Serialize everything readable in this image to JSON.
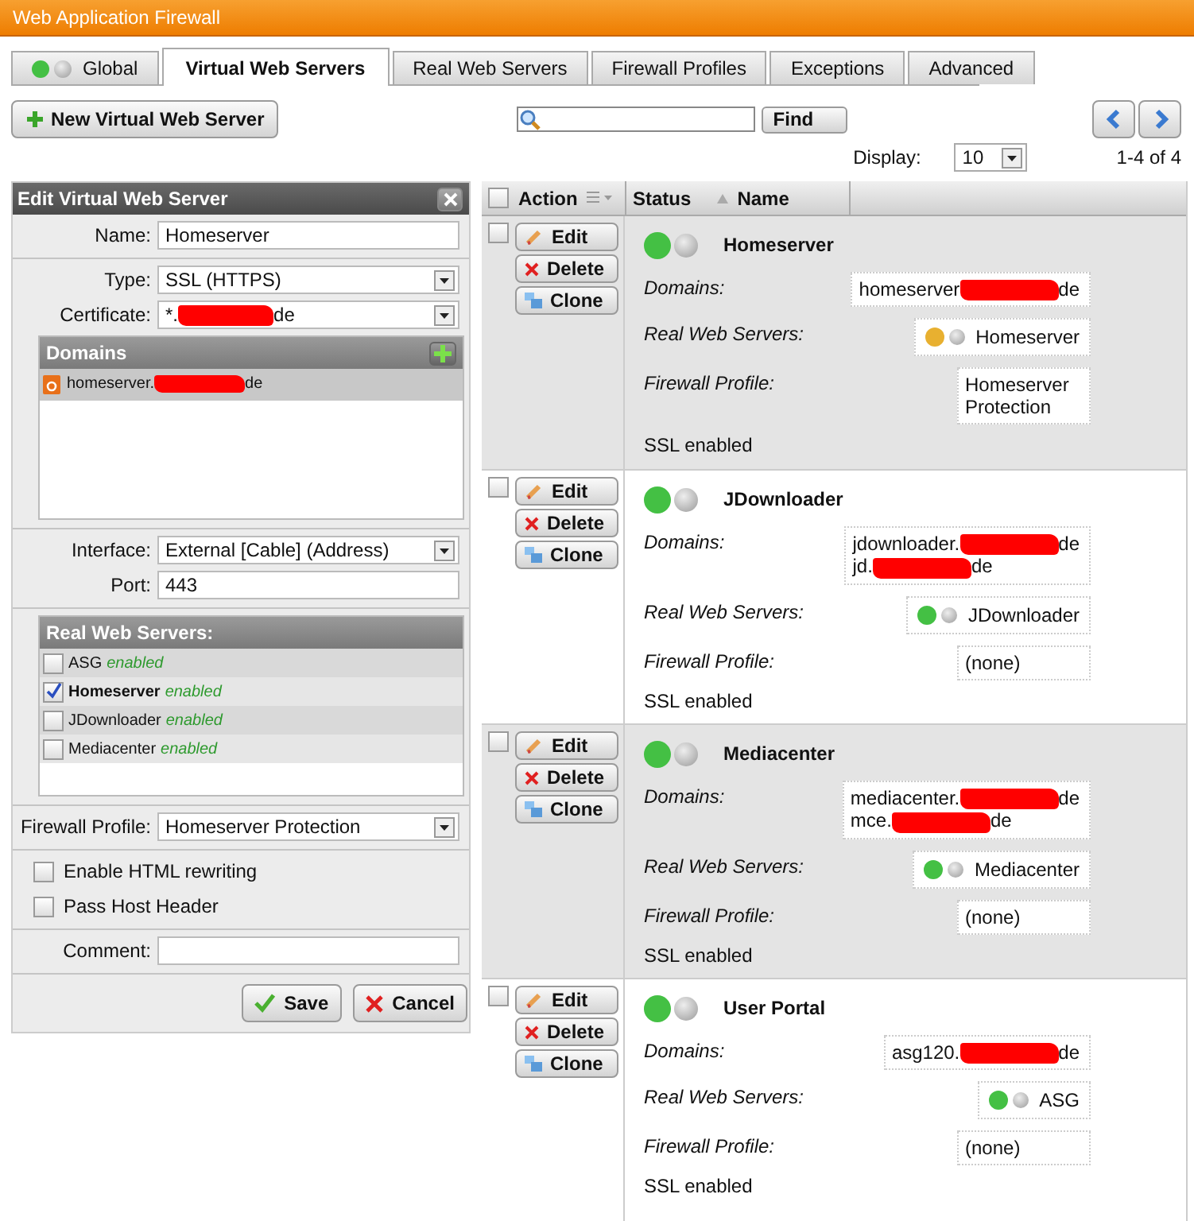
{
  "window": {
    "title": "Web Application Firewall"
  },
  "tabs": [
    {
      "label": "Global",
      "kind": "status",
      "color": "#44c044",
      "selected": false
    },
    {
      "label": "Virtual Web Servers",
      "kind": "plain",
      "selected": true
    },
    {
      "label": "Real Web Servers",
      "kind": "plain",
      "selected": false
    },
    {
      "label": "Firewall Profiles",
      "kind": "plain",
      "selected": false
    },
    {
      "label": "Exceptions",
      "kind": "plain",
      "selected": false
    },
    {
      "label": "Advanced",
      "kind": "plain",
      "selected": false
    }
  ],
  "toolbar": {
    "new_button": "New Virtual Web Server",
    "find_button": "Find"
  },
  "pagination": {
    "display_label": "Display:",
    "page_size": "10",
    "range": "1-4 of 4"
  },
  "editor": {
    "title": "Edit Virtual Web Server",
    "sections": [
      [
        {
          "kind": "text",
          "label": "Name:",
          "value": "Homeserver"
        }
      ],
      [
        {
          "kind": "select",
          "label": "Type:",
          "value": "SSL (HTTPS)"
        },
        {
          "kind": "select",
          "label": "Certificate:",
          "value": {
            "before": "*.",
            "after": "de"
          }
        },
        {
          "kind": "list",
          "title": "Domains",
          "items": [
            {
              "before": "homeserver.",
              "after": "de",
              "selected": true
            }
          ]
        }
      ],
      [
        {
          "kind": "select",
          "label": "Interface:",
          "value": "External [Cable] (Address)"
        },
        {
          "kind": "text",
          "label": "Port:",
          "value": "443"
        }
      ],
      [
        {
          "kind": "servers",
          "title": "Real Web Servers:",
          "items": [
            {
              "name": "ASG",
              "status": "enabled",
              "checked": false
            },
            {
              "name": "Homeserver",
              "status": "enabled",
              "checked": true
            },
            {
              "name": "JDownloader",
              "status": "enabled",
              "checked": false
            },
            {
              "name": "Mediacenter",
              "status": "enabled",
              "checked": false
            }
          ]
        }
      ],
      [
        {
          "kind": "select",
          "label": "Firewall Profile:",
          "value": "Homeserver Protection"
        }
      ],
      [
        {
          "kind": "checkbox",
          "label": "Enable HTML rewriting",
          "checked": false
        },
        {
          "kind": "checkbox",
          "label": "Pass Host Header",
          "checked": false
        }
      ],
      [
        {
          "kind": "text",
          "label": "Comment:"
        }
      ]
    ],
    "buttons": [
      {
        "label": "Save",
        "kind": "save"
      },
      {
        "label": "Cancel",
        "kind": "cancel"
      }
    ]
  },
  "table": {
    "select_all_checked": false,
    "columns": [
      {
        "label": "Action",
        "kind": "action"
      },
      {
        "label": "Status",
        "kind": "plain"
      },
      {
        "label": "Name",
        "kind": "sorted"
      }
    ],
    "rows": [
      {
        "checked": false,
        "actions": [
          {
            "label": "Edit",
            "kind": "edit"
          },
          {
            "label": "Delete",
            "kind": "delete"
          },
          {
            "label": "Clone",
            "kind": "clone"
          }
        ],
        "color": "#44c044",
        "name": "Homeserver",
        "domains_label": "Domains:",
        "domains": [
          {
            "before": "homeserver",
            "after": "de"
          }
        ],
        "servers_label": "Real Web Servers:",
        "servers": [
          {
            "name": "Homeserver",
            "color": "#e8b030"
          }
        ],
        "profile_label": "Firewall Profile:",
        "profile": "Homeserver Protection",
        "footer": "SSL enabled"
      },
      {
        "checked": false,
        "actions": [
          {
            "label": "Edit",
            "kind": "edit"
          },
          {
            "label": "Delete",
            "kind": "delete"
          },
          {
            "label": "Clone",
            "kind": "clone"
          }
        ],
        "color": "#44c044",
        "name": "JDownloader",
        "domains_label": "Domains:",
        "domains": [
          {
            "before": "jdownloader.",
            "after": "de"
          },
          {
            "before": "jd.",
            "after": "de"
          }
        ],
        "servers_label": "Real Web Servers:",
        "servers": [
          {
            "name": "JDownloader",
            "color": "#44c044"
          }
        ],
        "profile_label": "Firewall Profile:",
        "profile": "(none)",
        "footer": "SSL enabled"
      },
      {
        "checked": false,
        "actions": [
          {
            "label": "Edit",
            "kind": "edit"
          },
          {
            "label": "Delete",
            "kind": "delete"
          },
          {
            "label": "Clone",
            "kind": "clone"
          }
        ],
        "color": "#44c044",
        "name": "Mediacenter",
        "domains_label": "Domains:",
        "domains": [
          {
            "before": "mediacenter.",
            "after": "de"
          },
          {
            "before": "mce.",
            "after": "de"
          }
        ],
        "servers_label": "Real Web Servers:",
        "servers": [
          {
            "name": "Mediacenter",
            "color": "#44c044"
          }
        ],
        "profile_label": "Firewall Profile:",
        "profile": "(none)",
        "footer": "SSL enabled"
      },
      {
        "checked": false,
        "actions": [
          {
            "label": "Edit",
            "kind": "edit"
          },
          {
            "label": "Delete",
            "kind": "delete"
          },
          {
            "label": "Clone",
            "kind": "clone"
          }
        ],
        "color": "#44c044",
        "name": "User Portal",
        "domains_label": "Domains:",
        "domains": [
          {
            "before": "asg120.",
            "after": "de"
          }
        ],
        "servers_label": "Real Web Servers:",
        "servers": [
          {
            "name": "ASG",
            "color": "#44c044"
          }
        ],
        "profile_label": "Firewall Profile:",
        "profile": "(none)",
        "footer": "SSL enabled"
      }
    ]
  }
}
